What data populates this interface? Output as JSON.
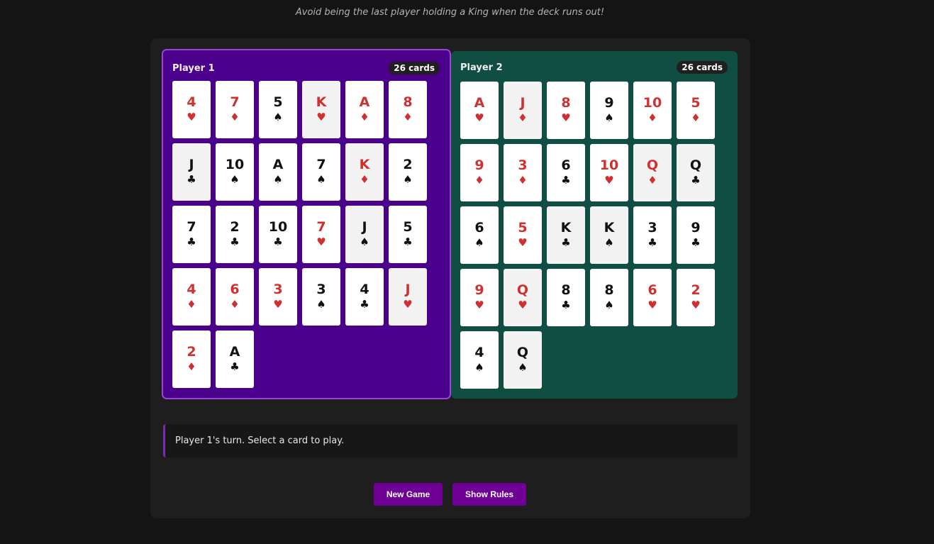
{
  "subtitle": "Avoid being the last player holding a King when the deck runs out!",
  "players": [
    {
      "name": "Player 1",
      "count": "26 cards",
      "cards": [
        {
          "rank": "4",
          "suit": "♥",
          "color": "red",
          "shade": false
        },
        {
          "rank": "7",
          "suit": "♦",
          "color": "red",
          "shade": false
        },
        {
          "rank": "5",
          "suit": "♠",
          "color": "black",
          "shade": false
        },
        {
          "rank": "K",
          "suit": "♥",
          "color": "red",
          "shade": true
        },
        {
          "rank": "A",
          "suit": "♦",
          "color": "red",
          "shade": false
        },
        {
          "rank": "8",
          "suit": "♦",
          "color": "red",
          "shade": false
        },
        {
          "rank": "J",
          "suit": "♣",
          "color": "black",
          "shade": true
        },
        {
          "rank": "10",
          "suit": "♠",
          "color": "black",
          "shade": false
        },
        {
          "rank": "A",
          "suit": "♠",
          "color": "black",
          "shade": false
        },
        {
          "rank": "7",
          "suit": "♠",
          "color": "black",
          "shade": false
        },
        {
          "rank": "K",
          "suit": "♦",
          "color": "red",
          "shade": true
        },
        {
          "rank": "2",
          "suit": "♠",
          "color": "black",
          "shade": false
        },
        {
          "rank": "7",
          "suit": "♣",
          "color": "black",
          "shade": false
        },
        {
          "rank": "2",
          "suit": "♣",
          "color": "black",
          "shade": false
        },
        {
          "rank": "10",
          "suit": "♣",
          "color": "black",
          "shade": false
        },
        {
          "rank": "7",
          "suit": "♥",
          "color": "red",
          "shade": false
        },
        {
          "rank": "J",
          "suit": "♠",
          "color": "black",
          "shade": true
        },
        {
          "rank": "5",
          "suit": "♣",
          "color": "black",
          "shade": false
        },
        {
          "rank": "4",
          "suit": "♦",
          "color": "red",
          "shade": false
        },
        {
          "rank": "6",
          "suit": "♦",
          "color": "red",
          "shade": false
        },
        {
          "rank": "3",
          "suit": "♥",
          "color": "red",
          "shade": false
        },
        {
          "rank": "3",
          "suit": "♠",
          "color": "black",
          "shade": false
        },
        {
          "rank": "4",
          "suit": "♣",
          "color": "black",
          "shade": false
        },
        {
          "rank": "J",
          "suit": "♥",
          "color": "red",
          "shade": true
        },
        {
          "rank": "2",
          "suit": "♦",
          "color": "red",
          "shade": false
        },
        {
          "rank": "A",
          "suit": "♣",
          "color": "black",
          "shade": false
        }
      ]
    },
    {
      "name": "Player 2",
      "count": "26 cards",
      "cards": [
        {
          "rank": "A",
          "suit": "♥",
          "color": "red",
          "shade": false
        },
        {
          "rank": "J",
          "suit": "♦",
          "color": "red",
          "shade": true
        },
        {
          "rank": "8",
          "suit": "♥",
          "color": "red",
          "shade": false
        },
        {
          "rank": "9",
          "suit": "♠",
          "color": "black",
          "shade": false
        },
        {
          "rank": "10",
          "suit": "♦",
          "color": "red",
          "shade": false
        },
        {
          "rank": "5",
          "suit": "♦",
          "color": "red",
          "shade": false
        },
        {
          "rank": "9",
          "suit": "♦",
          "color": "red",
          "shade": false
        },
        {
          "rank": "3",
          "suit": "♦",
          "color": "red",
          "shade": false
        },
        {
          "rank": "6",
          "suit": "♣",
          "color": "black",
          "shade": false
        },
        {
          "rank": "10",
          "suit": "♥",
          "color": "red",
          "shade": false
        },
        {
          "rank": "Q",
          "suit": "♦",
          "color": "red",
          "shade": true
        },
        {
          "rank": "Q",
          "suit": "♣",
          "color": "black",
          "shade": true
        },
        {
          "rank": "6",
          "suit": "♠",
          "color": "black",
          "shade": false
        },
        {
          "rank": "5",
          "suit": "♥",
          "color": "red",
          "shade": false
        },
        {
          "rank": "K",
          "suit": "♣",
          "color": "black",
          "shade": true
        },
        {
          "rank": "K",
          "suit": "♠",
          "color": "black",
          "shade": true
        },
        {
          "rank": "3",
          "suit": "♣",
          "color": "black",
          "shade": false
        },
        {
          "rank": "9",
          "suit": "♣",
          "color": "black",
          "shade": false
        },
        {
          "rank": "9",
          "suit": "♥",
          "color": "red",
          "shade": false
        },
        {
          "rank": "Q",
          "suit": "♥",
          "color": "red",
          "shade": true
        },
        {
          "rank": "8",
          "suit": "♣",
          "color": "black",
          "shade": false
        },
        {
          "rank": "8",
          "suit": "♠",
          "color": "black",
          "shade": false
        },
        {
          "rank": "6",
          "suit": "♥",
          "color": "red",
          "shade": false
        },
        {
          "rank": "2",
          "suit": "♥",
          "color": "red",
          "shade": false
        },
        {
          "rank": "4",
          "suit": "♠",
          "color": "black",
          "shade": false
        },
        {
          "rank": "Q",
          "suit": "♠",
          "color": "black",
          "shade": true
        }
      ]
    }
  ],
  "status": "Player 1's turn. Select a card to play.",
  "buttons": {
    "new_game": "New Game",
    "show_rules": "Show Rules"
  },
  "colors": {
    "player1_panel": "#4b008b",
    "player2_panel": "#104d43",
    "button": "#6e0096",
    "red_suit": "#cf3030"
  }
}
